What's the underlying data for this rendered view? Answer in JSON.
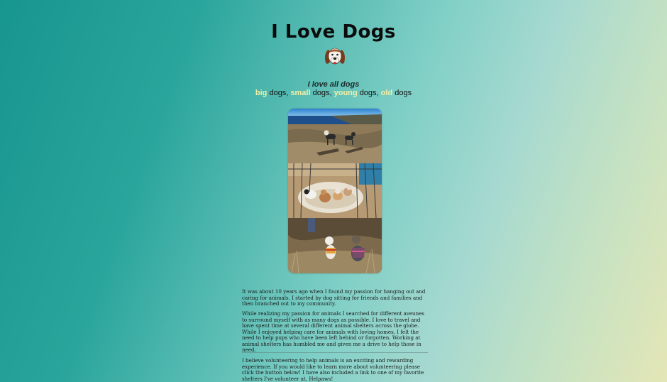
{
  "header": {
    "title": "I Love Dogs"
  },
  "icon": {
    "name": "dog-face-icon"
  },
  "tagline": "I love all dogs",
  "dogs_line": {
    "word_big": "big",
    "word_small": "small",
    "word_young": "young",
    "word_old": "old",
    "dogs": "dogs",
    "sep": ", "
  },
  "photos": [
    {
      "name": "dogs-on-coastal-cliff-photo"
    },
    {
      "name": "puppies-in-pen-photo"
    },
    {
      "name": "two-dogs-in-sweaters-photo"
    }
  ],
  "content": {
    "para1": "It was about 10 years ago when I found my passion for hanging out and caring for animals. I started by dog sitting for friends and families and then branched out to my community.",
    "para2": "While realizing my passion for animals I searched for different aveunes to surround myself with as many dogs as possible. I love to travel and have spent time at several different animal shelters across the globe. While I enjoyed helping care for animals with loving homes, I felt the need to help pups who have been left behind or forgotten. Working at animal shelters has humbled me and given me a drive to help those in need.",
    "para3": "I believe volunteering to help animals is an exciting and rewarding experience. If you would like to learn more about volunteering please click the button below! I have also included a link to one of my favorite shelters I've volunteer at, Helpaws!"
  },
  "colors": {
    "highlight": "#f3f0a6",
    "gradient_start": "#17958f",
    "gradient_end": "#e4e6b6"
  }
}
